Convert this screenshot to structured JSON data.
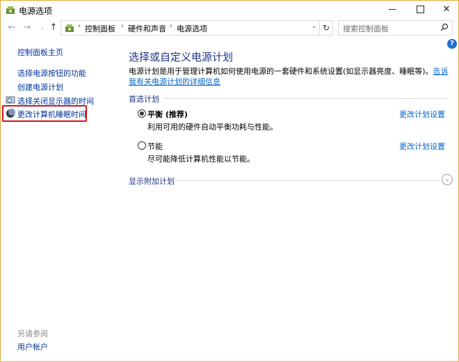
{
  "window": {
    "title": "电源选项",
    "accent": "#e3a83a"
  },
  "controls": {
    "minimize": "minimize-icon",
    "maximize": "maximize-icon",
    "close": "✕"
  },
  "nav": {
    "back": "←",
    "forward": "→",
    "recent": "⌄",
    "up": "↑",
    "refresh": "↻"
  },
  "address": {
    "crumbs": [
      "控制面板",
      "硬件和声音",
      "电源选项"
    ],
    "separator": "›"
  },
  "search": {
    "placeholder": "搜索控制面板"
  },
  "sidebar": {
    "items": [
      {
        "label": "控制面板主页"
      },
      {
        "label": "选择电源按钮的功能"
      },
      {
        "label": "创建电源计划"
      },
      {
        "label": "选择关闭显示器的时间"
      },
      {
        "label": "更改计算机睡眠时间"
      }
    ],
    "see_also": "另请参阅",
    "user_accounts": "用户帐户",
    "highlight_color": "#d0151b"
  },
  "help": {
    "label": "?"
  },
  "main": {
    "heading": "选择或自定义电源计划",
    "intro": "电源计划是用于管理计算机如何使用电源的一套硬件和系统设置(如显示器亮度、睡眠等)。",
    "intro_link": "告诉我有关电源计划的详细信息",
    "preferred_label": "首选计划",
    "plans": [
      {
        "name": "平衡 (推荐)",
        "desc": "利用可用的硬件自动平衡功耗与性能。",
        "link": "更改计划设置",
        "selected": true
      },
      {
        "name": "节能",
        "desc": "尽可能降低计算机性能以节能。",
        "link": "更改计划设置",
        "selected": false
      }
    ],
    "extra_label": "显示附加计划"
  }
}
